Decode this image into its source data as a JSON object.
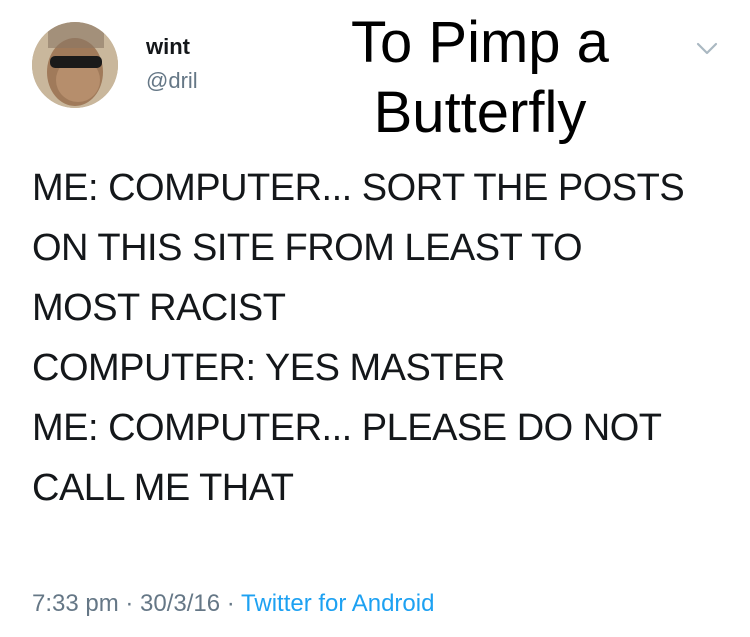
{
  "author": {
    "name": "wint",
    "handle": "@dril"
  },
  "caption": [
    "To Pimp a",
    "Butterfly"
  ],
  "tweet": {
    "lines": [
      "ME: COMPUTER... SORT THE POSTS",
      "ON THIS SITE FROM LEAST TO",
      "MOST RACIST",
      "COMPUTER: YES MASTER",
      "ME: COMPUTER... PLEASE DO NOT",
      "CALL ME THAT"
    ]
  },
  "meta": {
    "time": "7:33 pm",
    "sep1": " · ",
    "date": "30/3/16",
    "sep2": " · ",
    "source": "Twitter for Android"
  },
  "icons": {
    "avatar": "profile-photo",
    "menu": "chevron-down-icon"
  },
  "colors": {
    "handle": "#657786",
    "link": "#1da1f2"
  }
}
